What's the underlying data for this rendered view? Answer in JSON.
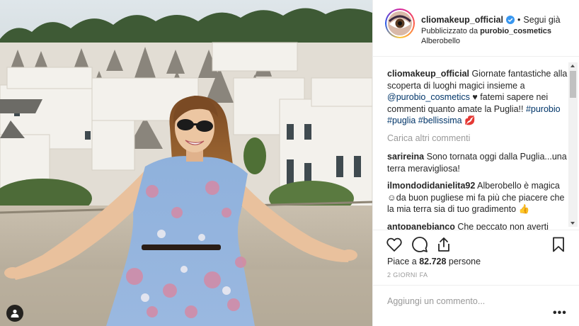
{
  "header": {
    "username": "cliomakeup_official",
    "verified": true,
    "follow_label": "Segui già",
    "sponsored_prefix": "Pubblicizzato da",
    "sponsor": "purobio_cosmetics",
    "location": "Alberobello"
  },
  "caption": {
    "username": "cliomakeup_official",
    "text_part1": "Giornate fantastiche alla scoperta di luoghi magici insieme a",
    "mention": "@purobio_cosmetics",
    "text_part2": "♥ fatemi sapere nei commenti quanto amate la Puglia!!",
    "hashtags": "#purobio #puglia #bellissima",
    "emoji": "💋"
  },
  "load_more_label": "Carica altri commenti",
  "comments": [
    {
      "username": "sarireina",
      "text": "Sono tornata oggi dalla Puglia...una terra meravigliosa!"
    },
    {
      "username": "ilmondodidanielita92",
      "text": "Alberobello è magica ☺da buon pugliese mi fa più che piacere che la mia terra sia di tuo gradimento 👍"
    },
    {
      "username": "antopanebianco",
      "text": "Che peccato non averti"
    }
  ],
  "likes": {
    "prefix": "Piace a",
    "count": "82.728",
    "suffix": "persone"
  },
  "timestamp": "2 GIORNI FA",
  "add_comment_placeholder": "Aggiungi un commento...",
  "more_options_label": "•••",
  "icons": {
    "like": "heart-icon",
    "comment": "comment-bubble-icon",
    "share": "share-icon",
    "save": "bookmark-icon",
    "user_tag": "person-tag-icon"
  },
  "colors": {
    "verified_blue": "#3897f0",
    "link_blue": "#003569",
    "muted_gray": "#999999",
    "text": "#262626"
  }
}
